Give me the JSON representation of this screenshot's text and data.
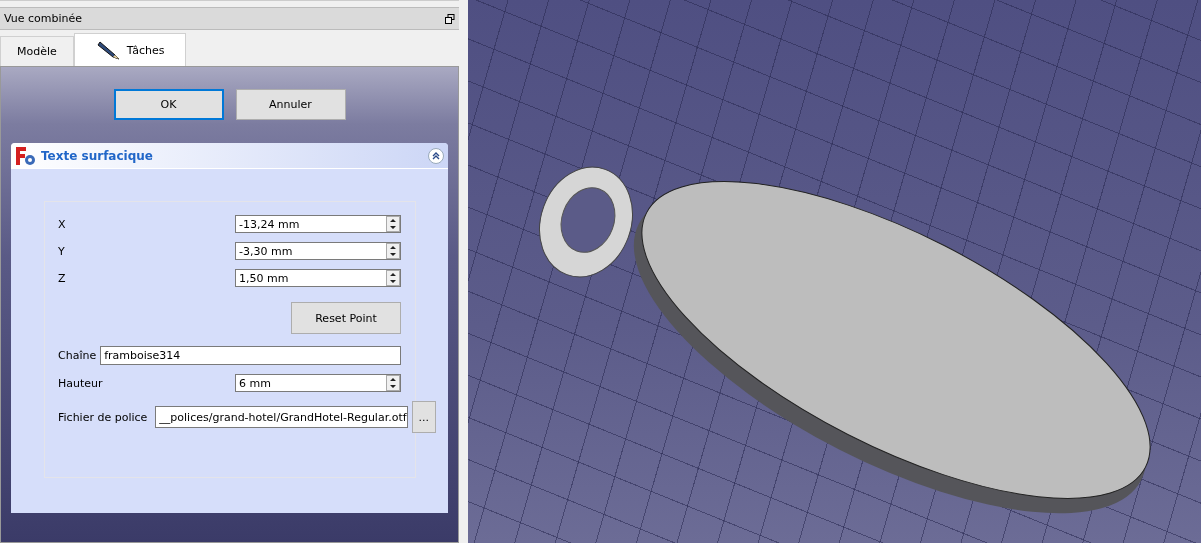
{
  "panel": {
    "title": "Vue combinée"
  },
  "tabs": [
    {
      "label": "Modèle",
      "selected": false,
      "icon": false
    },
    {
      "label": "Tâches",
      "selected": true,
      "icon": true
    }
  ],
  "dialog_buttons": [
    {
      "label": "OK",
      "focused": true
    },
    {
      "label": "Annuler",
      "focused": false
    }
  ],
  "task_box": {
    "title": "Texte surfacique",
    "expanded": true,
    "fields": [
      {
        "kind": "spin",
        "label": "X",
        "value": "-13,24 mm"
      },
      {
        "kind": "spin",
        "label": "Y",
        "value": "-3,30 mm"
      },
      {
        "kind": "spin",
        "label": "Z",
        "value": "1,50 mm"
      },
      {
        "kind": "button",
        "label": "Reset Point"
      },
      {
        "kind": "text",
        "label": "Chaîne",
        "value": "framboise314"
      },
      {
        "kind": "spin",
        "label": "Hauteur",
        "value": "6 mm"
      },
      {
        "kind": "file",
        "label": "Fichier de police",
        "value": "__polices/grand-hotel/GrandHotel-Regular.otf",
        "button": "..."
      }
    ]
  }
}
